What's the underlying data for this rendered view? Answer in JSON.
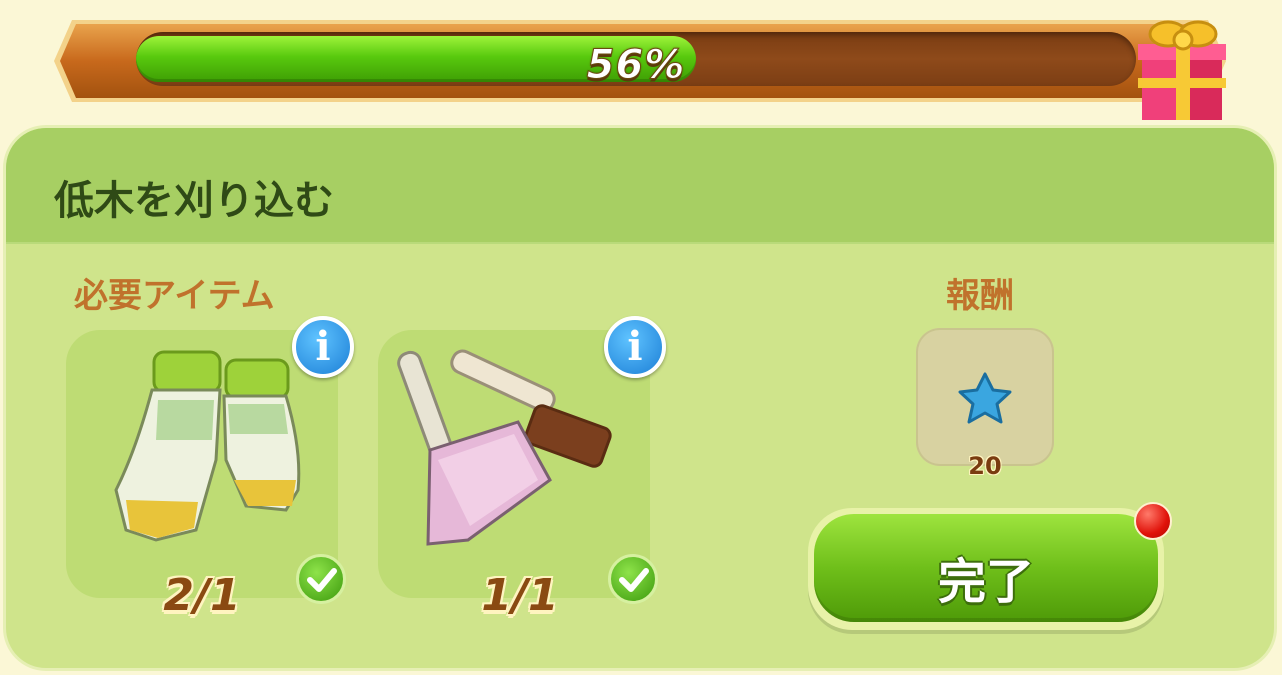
{
  "progress": {
    "value": 0.56,
    "label": "56%"
  },
  "task": {
    "title": "低木を刈り込む"
  },
  "required": {
    "label": "必要アイテム",
    "items": [
      {
        "name": "gardening-gloves",
        "count": "2/1",
        "complete": true
      },
      {
        "name": "dustpan-and-brush",
        "count": "1/1",
        "complete": true
      }
    ]
  },
  "reward": {
    "label": "報酬",
    "icon": "blue-star-icon",
    "value": "20"
  },
  "actions": {
    "complete_label": "完了"
  },
  "colors": {
    "panel": "#cfe48b",
    "header": "#a7cf63",
    "accent": "#c0722c",
    "button": "#6fbf1a"
  }
}
